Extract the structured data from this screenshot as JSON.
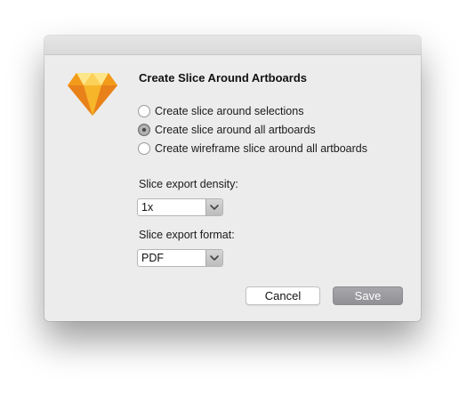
{
  "dialog": {
    "title": "Create Slice Around Artboards",
    "app_icon": "sketch-diamond-icon",
    "options": [
      {
        "label": "Create slice around selections",
        "checked": false
      },
      {
        "label": "Create slice around all artboards",
        "checked": true
      },
      {
        "label": "Create wireframe slice around all artboards",
        "checked": false
      }
    ],
    "density_label": "Slice export density:",
    "density_value": "1x",
    "format_label": "Slice export format:",
    "format_value": "PDF",
    "cancel_label": "Cancel",
    "save_label": "Save"
  },
  "colors": {
    "dialog_bg": "#ececec",
    "save_button": "#98989d",
    "icon_gold": "#f7b52a",
    "icon_orange": "#e8811a"
  }
}
